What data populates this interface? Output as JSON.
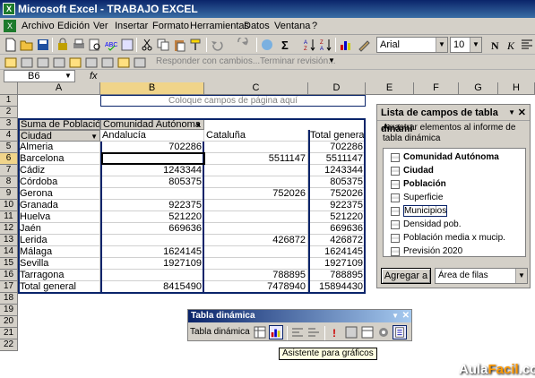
{
  "window": {
    "title": "Microsoft Excel - TRABAJO EXCEL"
  },
  "menu": [
    "Archivo",
    "Edición",
    "Ver",
    "Insertar",
    "Formato",
    "Herramientas",
    "Datos",
    "Ventana",
    "?"
  ],
  "font": {
    "name": "Arial",
    "size": "10"
  },
  "review_toolbar": {
    "reply_label": "Responder con cambios...",
    "finish_label": "Terminar revisión..."
  },
  "namebox": "B6",
  "fx": "fx",
  "columns": [
    "A",
    "B",
    "C",
    "D",
    "E",
    "F",
    "G",
    "H"
  ],
  "rows": [
    "1",
    "2",
    "3",
    "4",
    "5",
    "6",
    "7",
    "8",
    "9",
    "10",
    "11",
    "12",
    "13",
    "14",
    "15",
    "16",
    "17",
    "18",
    "19",
    "20",
    "21",
    "22"
  ],
  "pivot": {
    "page_drop_hint": "Coloque campos de página aquí",
    "data_field": "Suma de Población",
    "column_field": "Comunidad Autónoma",
    "row_field": "Ciudad",
    "col_headers": [
      "Andalucía",
      "Cataluña",
      "Total general"
    ],
    "rows": [
      {
        "city": "Almeria",
        "and": "702286",
        "cat": "",
        "tot": "702286"
      },
      {
        "city": "Barcelona",
        "and": "",
        "cat": "5511147",
        "tot": "5511147"
      },
      {
        "city": "Cádiz",
        "and": "1243344",
        "cat": "",
        "tot": "1243344"
      },
      {
        "city": "Córdoba",
        "and": "805375",
        "cat": "",
        "tot": "805375"
      },
      {
        "city": "Gerona",
        "and": "",
        "cat": "752026",
        "tot": "752026"
      },
      {
        "city": "Granada",
        "and": "922375",
        "cat": "",
        "tot": "922375"
      },
      {
        "city": "Huelva",
        "and": "521220",
        "cat": "",
        "tot": "521220"
      },
      {
        "city": "Jaén",
        "and": "669636",
        "cat": "",
        "tot": "669636"
      },
      {
        "city": "Lerida",
        "and": "",
        "cat": "426872",
        "tot": "426872"
      },
      {
        "city": "Málaga",
        "and": "1624145",
        "cat": "",
        "tot": "1624145"
      },
      {
        "city": "Sevilla",
        "and": "1927109",
        "cat": "",
        "tot": "1927109"
      },
      {
        "city": "Tarragona",
        "and": "",
        "cat": "788895",
        "tot": "788895"
      }
    ],
    "total": {
      "label": "Total general",
      "and": "8415490",
      "cat": "7478940",
      "tot": "15894430"
    }
  },
  "panel": {
    "title": "Lista de campos de tabla dinámi",
    "desc": "Arrastrar elementos al informe de tabla dinámica",
    "fields": [
      {
        "label": "Comunidad Autónoma",
        "bold": true,
        "selected": false
      },
      {
        "label": "Ciudad",
        "bold": true,
        "selected": false
      },
      {
        "label": "Población",
        "bold": true,
        "selected": false
      },
      {
        "label": "Superficie",
        "bold": false,
        "selected": false
      },
      {
        "label": "Municipios",
        "bold": false,
        "selected": true
      },
      {
        "label": "Densidad pob.",
        "bold": false,
        "selected": false
      },
      {
        "label": "Población media x mucip.",
        "bold": false,
        "selected": false
      },
      {
        "label": "Previsión 2020",
        "bold": false,
        "selected": false
      }
    ],
    "add_button": "Agregar a",
    "area_select": "Área de filas"
  },
  "pivot_toolbar": {
    "title": "Tabla dinámica",
    "dropdown": "Tabla dinámica"
  },
  "tooltip": "Asistente para gráficos",
  "watermark": {
    "part1": "Aula",
    "part2": "Facil",
    "part3": ".com"
  }
}
